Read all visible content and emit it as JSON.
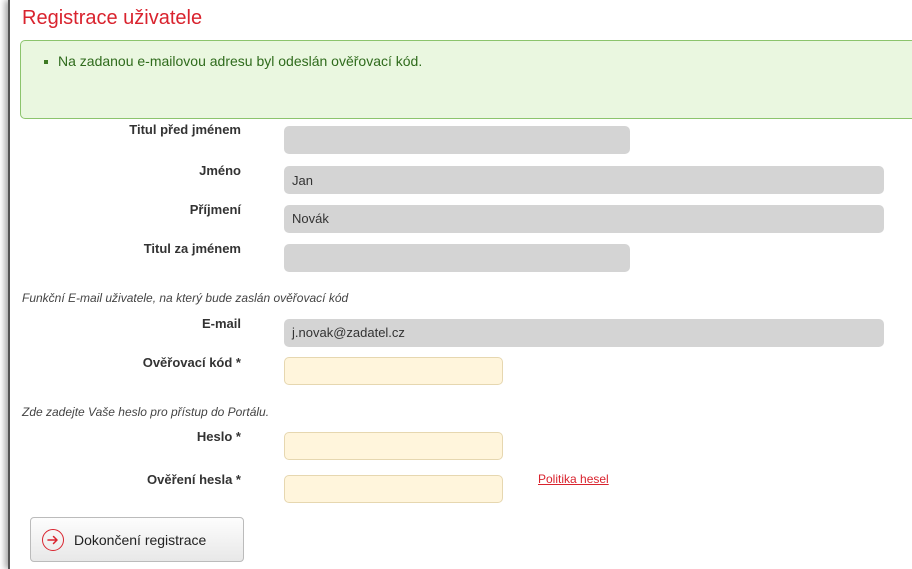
{
  "page": {
    "title": "Registrace uživatele"
  },
  "alert": {
    "message": "Na zadanou e-mailovou adresu byl odeslán ověřovací kód."
  },
  "form": {
    "titul_pred": {
      "label": "Titul před jménem",
      "value": ""
    },
    "jmeno": {
      "label": "Jméno",
      "value": "Jan"
    },
    "prijmeni": {
      "label": "Příjmení",
      "value": "Novák"
    },
    "titul_za": {
      "label": "Titul za jménem",
      "value": ""
    },
    "email_note": "Funkční E-mail uživatele, na který bude zaslán ověřovací kód",
    "email": {
      "label": "E-mail",
      "value": "j.novak@zadatel.cz"
    },
    "overovaci_kod": {
      "label": "Ověřovací kód *",
      "value": ""
    },
    "password_note": "Zde zadejte Vaše heslo pro přístup do Portálu.",
    "heslo": {
      "label": "Heslo *",
      "value": ""
    },
    "overeni_hesla": {
      "label": "Ověření hesla *",
      "value": ""
    },
    "policy_link": "Politika hesel"
  },
  "submit": {
    "label": "Dokončení registrace",
    "icon": "arrow-right-circle-icon"
  },
  "colors": {
    "accent": "#d9232e",
    "alert_bg": "#eaf7e0",
    "readonly_bg": "#d4d4d4",
    "required_bg": "#fff5dc"
  }
}
